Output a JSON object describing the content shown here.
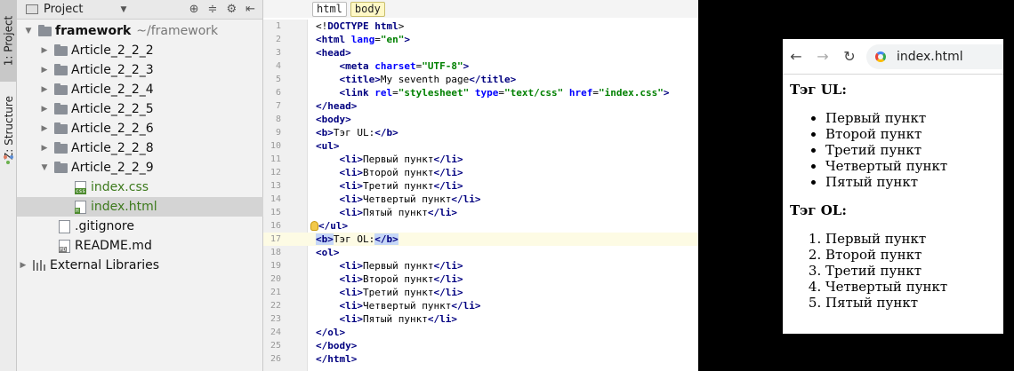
{
  "toolstrip": {
    "project_tab": "1: Project",
    "structure_tab": "Z: Structure"
  },
  "project_panel": {
    "header_label": "Project",
    "tree": [
      {
        "label": "framework",
        "suffix": "~/framework",
        "kind": "folder",
        "expanded": true
      },
      {
        "label": "Article_2_2_2",
        "kind": "folder"
      },
      {
        "label": "Article_2_2_3",
        "kind": "folder"
      },
      {
        "label": "Article_2_2_4",
        "kind": "folder"
      },
      {
        "label": "Article_2_2_5",
        "kind": "folder"
      },
      {
        "label": "Article_2_2_6",
        "kind": "folder"
      },
      {
        "label": "Article_2_2_8",
        "kind": "folder"
      },
      {
        "label": "Article_2_2_9",
        "kind": "folder",
        "expanded": true
      },
      {
        "label": "index.css",
        "kind": "file",
        "badge": "css"
      },
      {
        "label": "index.html",
        "kind": "file",
        "badge": "H",
        "selected": true
      },
      {
        "label": ".gitignore",
        "kind": "file",
        "badge": ""
      },
      {
        "label": "README.md",
        "kind": "file",
        "badge": "MD"
      },
      {
        "label": "External Libraries",
        "kind": "library"
      }
    ]
  },
  "editor": {
    "breadcrumb": [
      "html",
      "body"
    ],
    "current_line": 17,
    "lines": [
      "<!DOCTYPE html>",
      "<html lang=\"en\">",
      "<head>",
      "    <meta charset=\"UTF-8\">",
      "    <title>My seventh page</title>",
      "    <link rel=\"stylesheet\" type=\"text/css\" href=\"index.css\">",
      "</head>",
      "<body>",
      "<b>Тэг UL:</b>",
      "<ul>",
      "    <li>Первый пункт</li>",
      "    <li>Второй пункт</li>",
      "    <li>Третий пункт</li>",
      "    <li>Четвертый пункт</li>",
      "    <li>Пятый пункт</li>",
      "</ul>",
      "<b>Тэг OL:</b>",
      "<ol>",
      "    <li>Первый пункт</li>",
      "    <li>Второй пункт</li>",
      "    <li>Третий пункт</li>",
      "    <li>Четвертый пункт</li>",
      "    <li>Пятый пункт</li>",
      "</ol>",
      "</body>",
      "</html>"
    ]
  },
  "browser": {
    "address": "index.html",
    "icons": {
      "back": "arrow-left-icon",
      "forward": "arrow-right-icon",
      "reload": "reload-icon",
      "site": "google-icon"
    },
    "page": {
      "ul_heading": "Тэг UL:",
      "ul_items": [
        "Первый пункт",
        "Второй пункт",
        "Третий пункт",
        "Четвертый пункт",
        "Пятый пункт"
      ],
      "ol_heading": "Тэг OL:",
      "ol_items": [
        "Первый пункт",
        "Второй пункт",
        "Третий пункт",
        "Четвертый пункт",
        "Пятый пункт"
      ]
    }
  },
  "colors": {
    "tag": "#000080",
    "attribute": "#0000ff",
    "string": "#008000",
    "selection": "#c6d7f7",
    "current_line": "#fdfbe4",
    "file_name_green": "#3d7a1d"
  }
}
